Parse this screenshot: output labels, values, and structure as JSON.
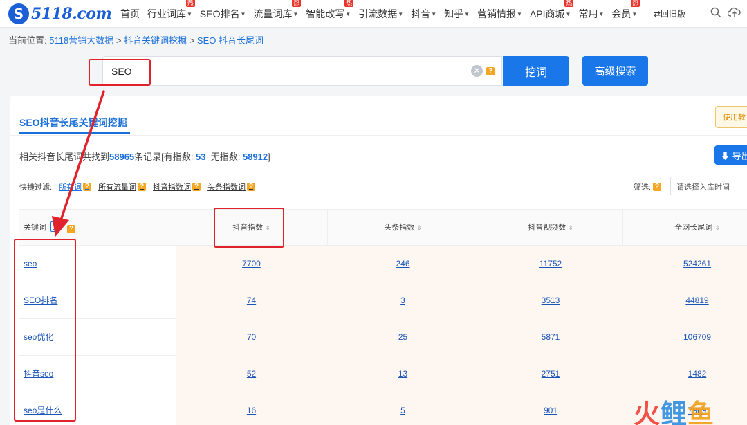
{
  "logo": {
    "mark": "S",
    "text": "5118.com"
  },
  "nav": {
    "items": [
      {
        "label": "首页",
        "caret": false,
        "hot": false
      },
      {
        "label": "行业词库",
        "caret": true,
        "hot": true
      },
      {
        "label": "SEO排名",
        "caret": true,
        "hot": false
      },
      {
        "label": "流量词库",
        "caret": true,
        "hot": true
      },
      {
        "label": "智能改写",
        "caret": true,
        "hot": true
      },
      {
        "label": "引流数据",
        "caret": true,
        "hot": false
      },
      {
        "label": "抖音",
        "caret": true,
        "hot": false
      },
      {
        "label": "知乎",
        "caret": true,
        "hot": false
      },
      {
        "label": "营销情报",
        "caret": true,
        "hot": false
      },
      {
        "label": "API商城",
        "caret": true,
        "hot": true
      },
      {
        "label": "常用",
        "caret": true,
        "hot": false
      },
      {
        "label": "会员",
        "caret": true,
        "hot": true
      }
    ],
    "hot_badge": "热",
    "old_version": "⇄回旧版"
  },
  "breadcrumb": {
    "prefix": "当前位置:",
    "items": [
      "5118营销大数据",
      "抖音关键词挖掘",
      "SEO 抖音长尾词"
    ],
    "separator": ">"
  },
  "search": {
    "value": "SEO",
    "help": "?",
    "dig_button": "挖词",
    "advanced_button": "高级搜索"
  },
  "panel": {
    "title": "SEO抖音长尾关键词挖掘",
    "usage_button": "使用教",
    "summary": {
      "prefix": "相关抖音长尾词共找到",
      "total": "58965",
      "middle": "条记录[有指数:",
      "with_index": "53",
      "no_index_label": "无指数:",
      "no_index": "58912",
      "suffix": "]"
    },
    "export_button": "⬇ 导出",
    "filters": {
      "label": "快捷过滤:",
      "items": [
        "所有词",
        "所有流量词",
        "抖音指数词",
        "头条指数词"
      ]
    },
    "screen_label": "筛选:",
    "date_placeholder": "请选择入库时间"
  },
  "table": {
    "headers": [
      "关键词",
      "抖音指数",
      "头条指数",
      "抖音视频数",
      "全网长尾词"
    ],
    "rows": [
      {
        "keyword": "seo",
        "douyin_index": "7700",
        "toutiao_index": "246",
        "videos": "11752",
        "longtail": "524261"
      },
      {
        "keyword": "SEO排名",
        "douyin_index": "74",
        "toutiao_index": "3",
        "videos": "3513",
        "longtail": "44819"
      },
      {
        "keyword": "seo优化",
        "douyin_index": "70",
        "toutiao_index": "25",
        "videos": "5871",
        "longtail": "106709"
      },
      {
        "keyword": "抖音seo",
        "douyin_index": "52",
        "toutiao_index": "13",
        "videos": "2751",
        "longtail": "1482"
      },
      {
        "keyword": "seo是什么",
        "douyin_index": "16",
        "toutiao_index": "5",
        "videos": "901",
        "longtail": "7969"
      }
    ]
  },
  "watermark": {
    "c1": "火",
    "c2": "鲤",
    "c3": "鱼"
  },
  "colors": {
    "brand": "#1977ea",
    "annotation": "#e0222c",
    "hot": "#e8342a"
  }
}
